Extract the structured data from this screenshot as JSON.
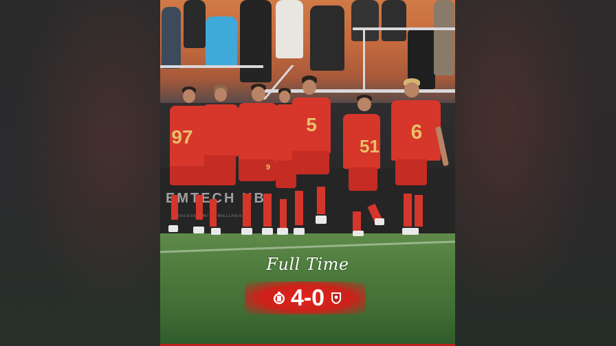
{
  "caption": {
    "headline": "Full Time",
    "score": "4-0"
  },
  "home_team": {
    "crest": "home-crest-icon"
  },
  "away_team": {
    "crest": "away-crest-icon"
  },
  "colors": {
    "kit_red": "#d7362a",
    "number_gold": "#e8c06a",
    "score_panel": "#e1231c"
  },
  "background_text": {
    "ad_board": "EMTECH UB",
    "ad_board_sub": "OBSESSED WITH WELLNESS"
  },
  "players": [
    {
      "number": "97"
    },
    {
      "number": "9"
    },
    {
      "number": "5"
    },
    {
      "number": "51"
    },
    {
      "number": "6"
    }
  ]
}
